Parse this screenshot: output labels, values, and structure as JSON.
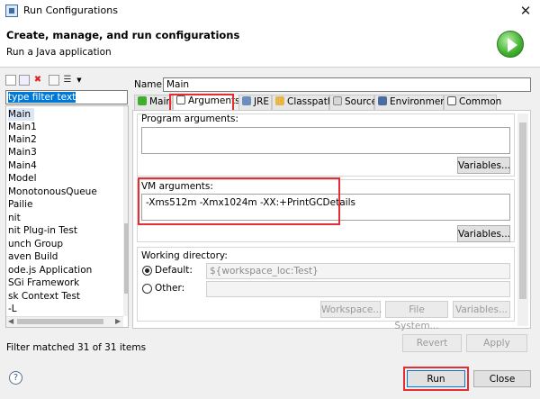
{
  "window": {
    "title": "Run Configurations",
    "close_glyph": "✕"
  },
  "header": {
    "title": "Create, manage, and run configurations",
    "subtitle": "Run a Java application",
    "icon": "run-icon"
  },
  "left": {
    "filter_text": "type filter text",
    "items": [
      "Main",
      "Main1",
      "Main2",
      "Main3",
      "Main4",
      "Model",
      "MonotonousQueue",
      "Pailie",
      "nit",
      "nit Plug-in Test",
      "unch Group",
      "aven Build",
      "ode.js Application",
      "SGi Framework",
      "sk Context Test",
      "-L"
    ],
    "selected_index": 0,
    "status": "Filter matched 31 of 31 items"
  },
  "name": {
    "label": "Name:",
    "value": "Main"
  },
  "tabs": [
    "Main",
    "Arguments",
    "JRE",
    "Classpath",
    "Source",
    "Environment",
    "Common"
  ],
  "active_tab": "Arguments",
  "program_args": {
    "label": "Program arguments:",
    "value": "",
    "variables_btn": "Variables..."
  },
  "vm_args": {
    "label": "VM arguments:",
    "value": "-Xms512m -Xmx1024m -XX:+PrintGCDetails",
    "variables_btn": "Variables..."
  },
  "working_dir": {
    "label": "Working directory:",
    "default_label": "Default:",
    "default_value": "${workspace_loc:Test}",
    "other_label": "Other:",
    "other_value": "",
    "buttons": [
      "Workspace...",
      "File System...",
      "Variables..."
    ]
  },
  "actions": {
    "revert": "Revert",
    "apply": "Apply"
  },
  "footer": {
    "help": "?",
    "run": "Run",
    "close": "Close"
  },
  "colors": {
    "highlight_red": "#e52d32",
    "selection_blue": "#0078d7",
    "run_green": "#3fae2e"
  }
}
